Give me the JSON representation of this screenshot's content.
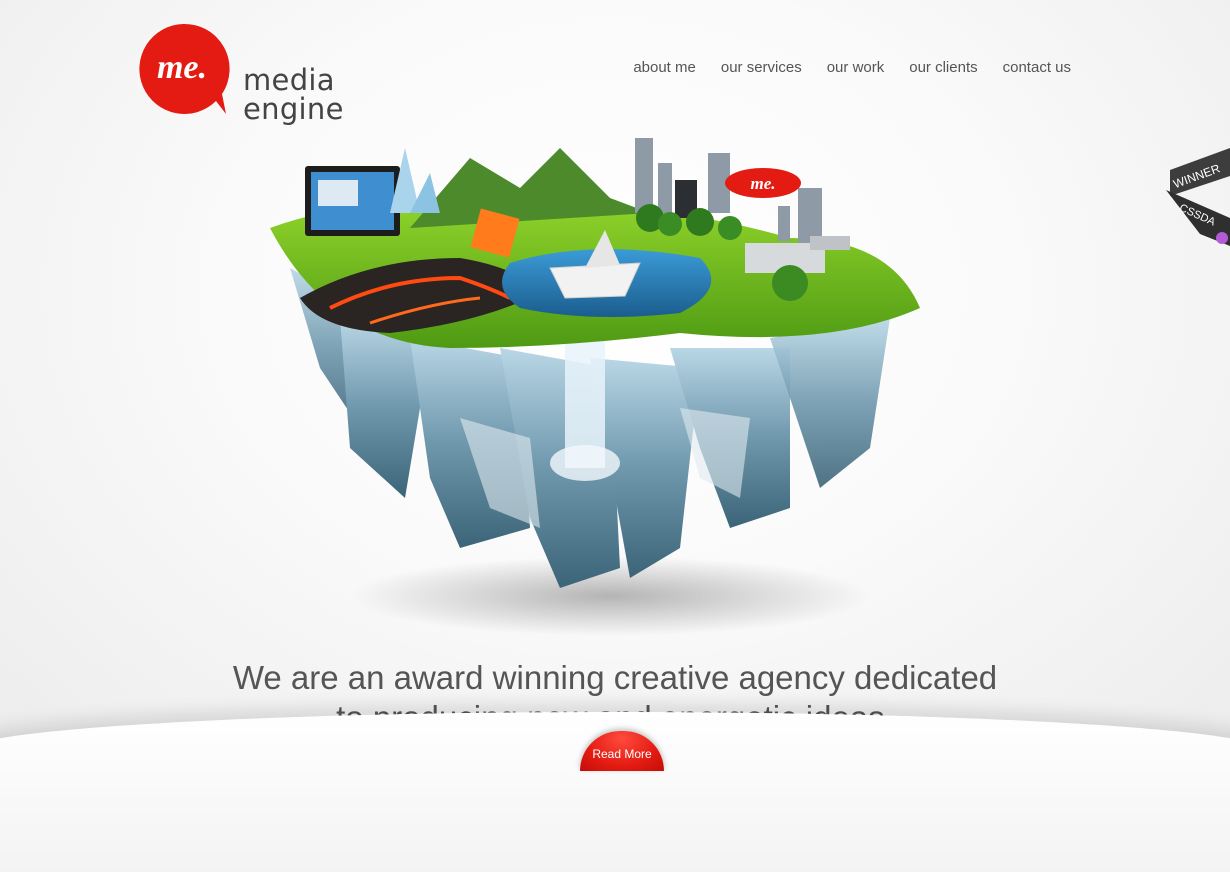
{
  "header": {
    "logo_badge_text": "me.",
    "brand_name": "media engine"
  },
  "nav": {
    "items": [
      {
        "label": "about me"
      },
      {
        "label": "our services"
      },
      {
        "label": "our work"
      },
      {
        "label": "our clients"
      },
      {
        "label": "contact us"
      }
    ]
  },
  "hero": {
    "illustration": "floating-island-illustration",
    "blimp_text": "me."
  },
  "headline": {
    "line1": "We are an award winning creative agency dedicated",
    "line2": "to producing new and energetic ideas."
  },
  "cta": {
    "label": "Read More"
  },
  "award_ribbon": {
    "line1": "WINNER",
    "line2": "CSSDA"
  },
  "colors": {
    "brand_red": "#e31b12",
    "text": "#555555",
    "background": "#f7f7f7"
  }
}
